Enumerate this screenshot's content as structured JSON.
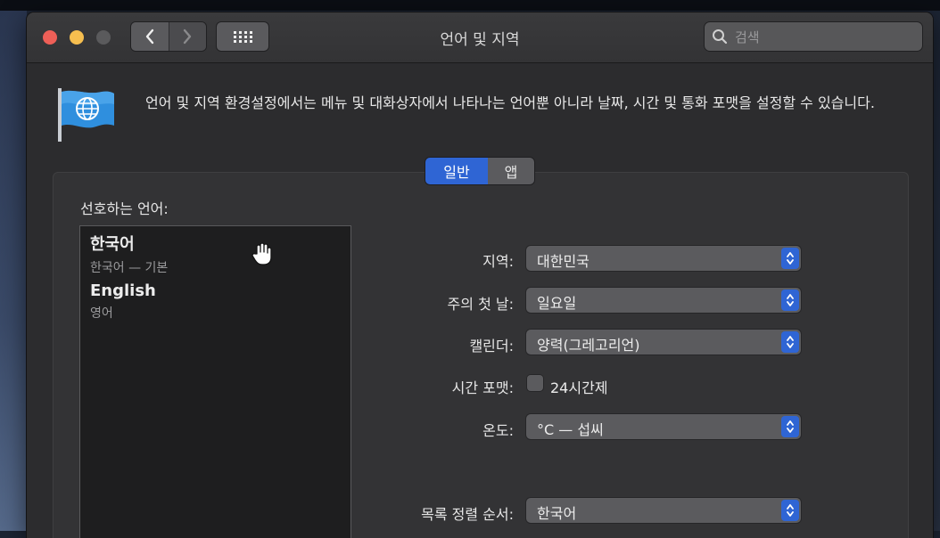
{
  "window": {
    "title": "언어 및 지역"
  },
  "search": {
    "placeholder": "검색"
  },
  "header": {
    "description": "언어 및 지역 환경설정에서는 메뉴 및 대화상자에서 나타나는 언어뿐 아니라 날짜, 시간 및 통화 포맷을 설정할 수 있습니다."
  },
  "tabs": [
    {
      "label": "일반",
      "selected": true
    },
    {
      "label": "앱",
      "selected": false
    }
  ],
  "preferred_languages": {
    "label": "선호하는 언어:",
    "items": [
      {
        "name": "한국어",
        "subtitle": "한국어 — 기본"
      },
      {
        "name": "English",
        "subtitle": "영어"
      }
    ]
  },
  "settings": {
    "region": {
      "label": "지역:",
      "value": "대한민국"
    },
    "first_day": {
      "label": "주의 첫 날:",
      "value": "일요일"
    },
    "calendar": {
      "label": "캘린더:",
      "value": "양력(그레고리언)"
    },
    "time_format": {
      "label": "시간 포맷:",
      "checkbox_label": "24시간제",
      "checked": false
    },
    "temperature": {
      "label": "온도:",
      "value": "°C — 섭씨"
    },
    "sort_order": {
      "label": "목록 정렬 순서:",
      "value": "한국어"
    }
  },
  "colors": {
    "accent": "#2f65d4",
    "window_bg": "#2c2c2e",
    "close": "#ee5f57",
    "minimize": "#f6be4f"
  },
  "icons": {
    "back": "chevron-left-icon",
    "forward": "chevron-right-icon",
    "show_all": "grid-icon",
    "search": "search-icon",
    "flag": "flag-globe-icon",
    "cursor": "hand-cursor-icon",
    "popup": "up-down-chevron-icon"
  }
}
